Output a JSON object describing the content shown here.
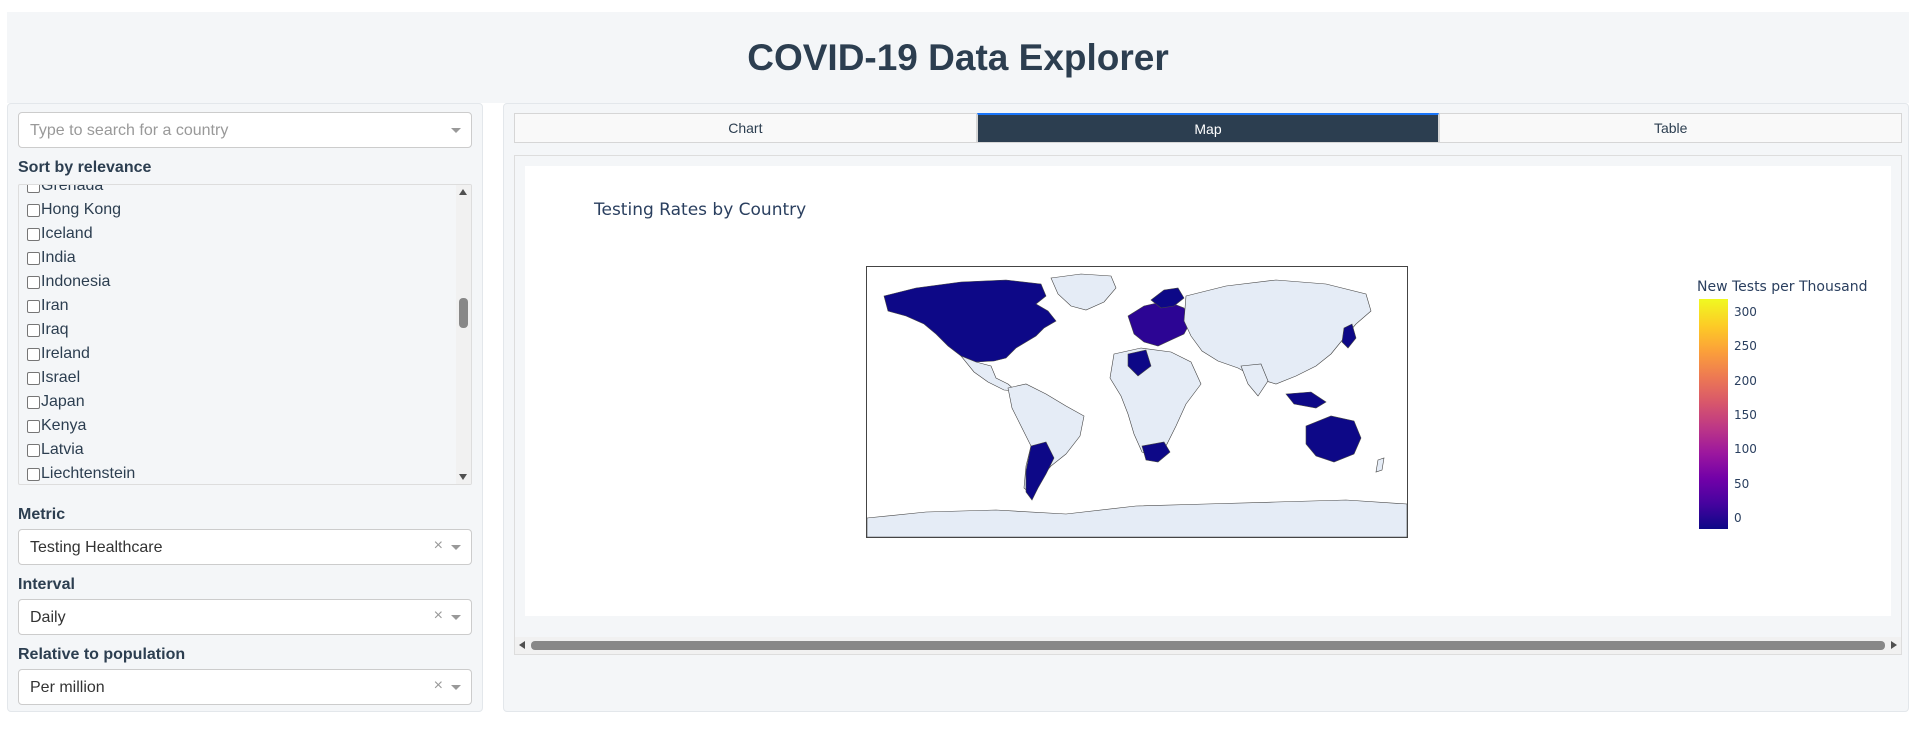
{
  "header": {
    "title": "COVID-19 Data Explorer"
  },
  "sidebar": {
    "search": {
      "placeholder": "Type to search for a country"
    },
    "sort_label": "Sort by relevance",
    "countries": [
      "Grenada",
      "Hong Kong",
      "Iceland",
      "India",
      "Indonesia",
      "Iran",
      "Iraq",
      "Ireland",
      "Israel",
      "Japan",
      "Kenya",
      "Latvia",
      "Liechtenstein"
    ],
    "metric": {
      "label": "Metric",
      "value": "Testing Healthcare",
      "clear": "×"
    },
    "interval": {
      "label": "Interval",
      "value": "Daily",
      "clear": "×"
    },
    "population": {
      "label": "Relative to population",
      "value": "Per million",
      "clear": "×"
    }
  },
  "main": {
    "tabs": [
      {
        "label": "Chart",
        "active": false
      },
      {
        "label": "Map",
        "active": true
      },
      {
        "label": "Table",
        "active": false
      }
    ],
    "chart": {
      "title": "Testing Rates by Country",
      "colorbar_title": "New Tests per Thousand",
      "colorbar_ticks": [
        "300",
        "250",
        "200",
        "150",
        "100",
        "50",
        "0"
      ],
      "colorscale": [
        "#0d0887",
        "#7201a8",
        "#bd3786",
        "#ed7953",
        "#f0f921"
      ],
      "land_color": "#e5ecf6"
    }
  }
}
